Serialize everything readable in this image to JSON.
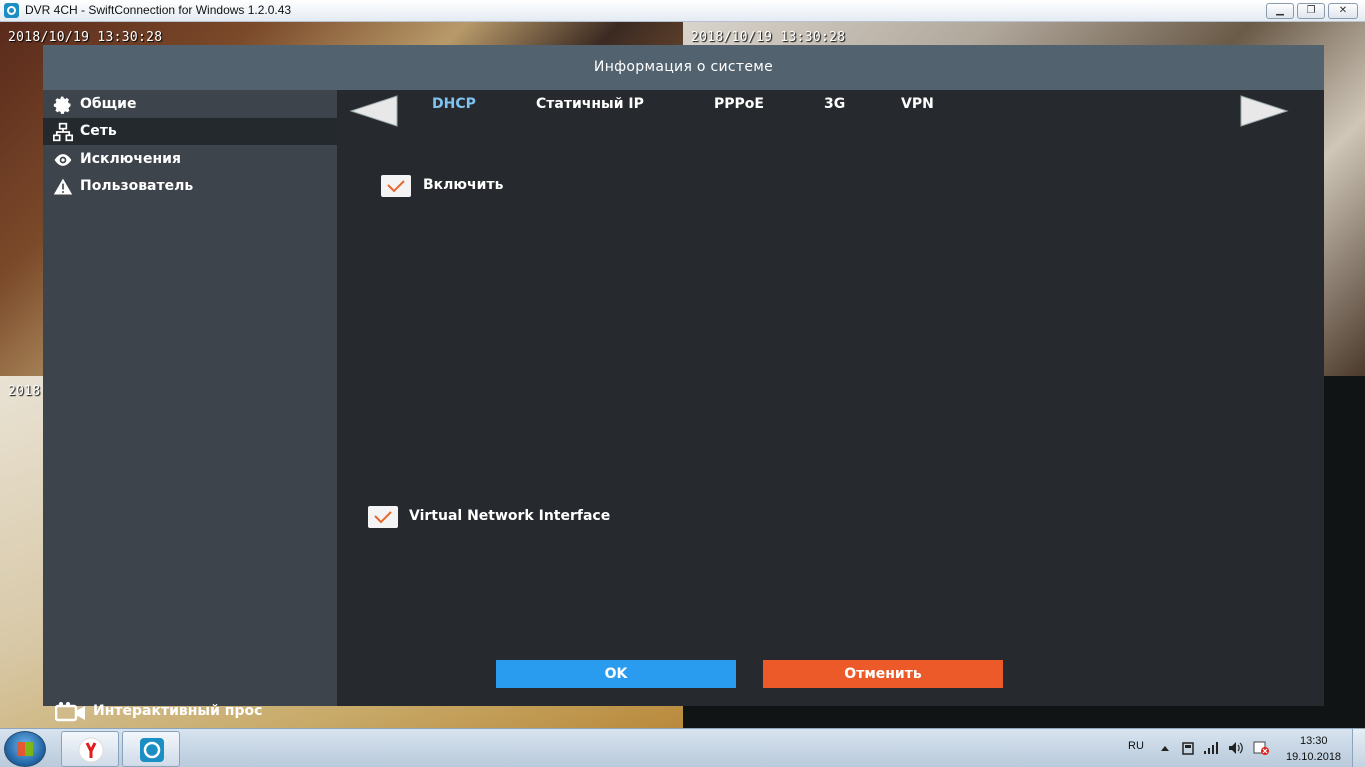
{
  "window": {
    "title": "DVR 4CH - SwiftConnection for Windows 1.2.0.43",
    "minimize": "▁",
    "maximize": "❐",
    "close": "✕"
  },
  "cameras": [
    {
      "timestamp": "2018/10/19 13:30:28"
    },
    {
      "timestamp": "2018/10/19 13:30:28"
    },
    {
      "timestamp": "2018"
    }
  ],
  "dialog": {
    "title": "Информация о системе",
    "sidebar": {
      "items": [
        {
          "label": "Общие",
          "icon": "gear-icon"
        },
        {
          "label": "Сеть",
          "icon": "network-icon"
        },
        {
          "label": "Исключения",
          "icon": "eye-icon"
        },
        {
          "label": "Пользователь",
          "icon": "warning-icon"
        }
      ],
      "active_index": 1,
      "bottom": {
        "label": "Интерактивный прос",
        "icon": "video-camera-icon"
      }
    },
    "tabs": [
      "DHCP",
      "Статичный IP",
      "PPPoE",
      "3G",
      "VPN"
    ],
    "active_tab": 0,
    "checkboxes": [
      {
        "label": "Включить",
        "checked": true
      },
      {
        "label": "Virtual Network Interface",
        "checked": true
      }
    ],
    "buttons": {
      "ok": "OK",
      "cancel": "Отменить"
    },
    "colors": {
      "ok": "#2a9cf0",
      "cancel": "#ec5a2a",
      "active_tab": "#7fc3f0",
      "header": "#52636f"
    }
  },
  "taskbar": {
    "language": "RU",
    "time": "13:30",
    "date": "19.10.2018"
  }
}
